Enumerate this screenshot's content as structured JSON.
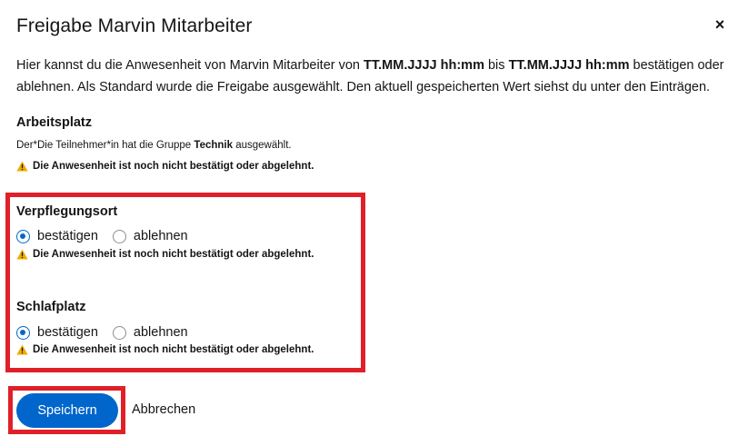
{
  "modal": {
    "title": "Freigabe Marvin Mitarbeiter",
    "close_glyph": "×"
  },
  "intro": {
    "part1": "Hier kannst du die Anwesenheit von Marvin Mitarbeiter von ",
    "date_from": "TT.MM.JJJJ hh:mm",
    "part2": " bis ",
    "date_to": "TT.MM.JJJJ hh:mm",
    "part3": " bestätigen oder ablehnen. Als Standard wurde die Freigabe ausgewählt. Den aktuell gespeicherten Wert siehst du unter den Einträgen."
  },
  "sections": {
    "arbeitsplatz": {
      "title": "Arbeitsplatz",
      "info_prefix": "Der*Die Teilnehmer*in hat die Gruppe ",
      "info_group": "Technik",
      "info_suffix": " ausgewählt.",
      "warning": "Die Anwesenheit ist noch nicht bestätigt oder abgelehnt."
    },
    "verpflegungsort": {
      "title": "Verpflegungsort",
      "option_confirm": "bestätigen",
      "option_reject": "ablehnen",
      "selected": "bestätigen",
      "warning": "Die Anwesenheit ist noch nicht bestätigt oder abgelehnt."
    },
    "schlafplatz": {
      "title": "Schlafplatz",
      "option_confirm": "bestätigen",
      "option_reject": "ablehnen",
      "selected": "bestätigen",
      "warning": "Die Anwesenheit ist noch nicht bestätigt oder abgelehnt."
    }
  },
  "footer": {
    "save_label": "Speichern",
    "cancel_label": "Abbrechen"
  },
  "colors": {
    "primary": "#0066cc",
    "warning": "#f0ab00",
    "highlight": "#e02028"
  },
  "icons": {
    "close": "close-icon",
    "warning": "warning-triangle-icon"
  }
}
